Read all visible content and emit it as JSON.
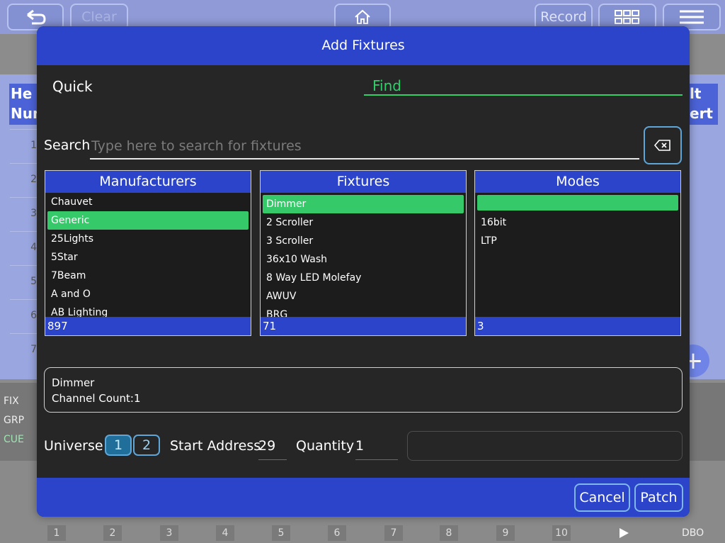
{
  "background": {
    "topbar": {
      "clear_label": "Clear",
      "record_label": "Record"
    },
    "table_heads": {
      "left": "He\nNum",
      "right": "lt\nert"
    },
    "row_numbers": [
      "1",
      "2",
      "3",
      "4",
      "5",
      "6",
      "7"
    ],
    "side_labels": {
      "fix": "FIX",
      "grp": "GRP",
      "cue": "CUE"
    },
    "bottom_numbers": [
      "1",
      "2",
      "3",
      "4",
      "5",
      "6",
      "7",
      "8",
      "9",
      "10"
    ],
    "dbo_label": "DBO"
  },
  "dialog": {
    "title": "Add Fixtures",
    "quick_label": "Quick",
    "find_label": "Find",
    "search": {
      "label": "Search",
      "placeholder": "Type here to search for fixtures",
      "value": ""
    },
    "manufacturers": {
      "title": "Manufacturers",
      "items": [
        "Chauvet",
        "Generic",
        "25Lights",
        "5Star",
        "7Beam",
        "A and O",
        "AB Lighting"
      ],
      "selected": 1,
      "count": "897"
    },
    "fixtures": {
      "title": "Fixtures",
      "items": [
        "Dimmer",
        "2 Scroller",
        "3 Scroller",
        "36x10 Wash",
        "8 Way LED Molefay",
        "AWUV",
        "BRG"
      ],
      "selected": 0,
      "count": "71"
    },
    "modes": {
      "title": "Modes",
      "items": [
        "",
        "16bit",
        "LTP"
      ],
      "selected": 0,
      "count": "3"
    },
    "info": {
      "name": "Dimmer",
      "channel_count": "Channel Count:1"
    },
    "universe": {
      "label": "Universe",
      "options": [
        "1",
        "2"
      ],
      "selected": "1"
    },
    "start_address": {
      "label": "Start Address",
      "value": "29"
    },
    "quantity": {
      "label": "Quantity",
      "value": "1"
    },
    "cancel_label": "Cancel",
    "patch_label": "Patch"
  },
  "colors": {
    "accent": "#2b44c9",
    "selection": "#35c969",
    "find": "#2fcf6a"
  }
}
